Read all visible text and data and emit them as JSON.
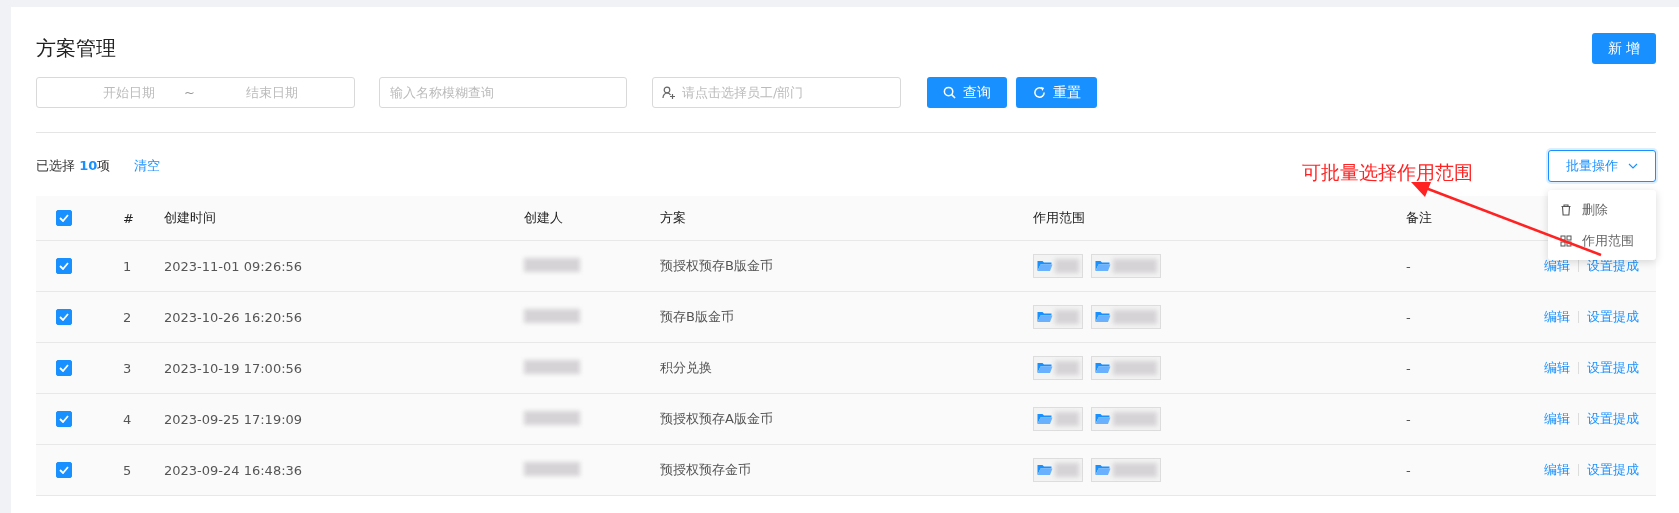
{
  "page": {
    "title": "方案管理",
    "add_button": "新 增"
  },
  "filters": {
    "start_date": {
      "placeholder": "开始日期"
    },
    "separator": "~",
    "end_date": {
      "placeholder": "结束日期"
    },
    "name_search": {
      "placeholder": "输入名称模糊查询"
    },
    "employee_picker": {
      "placeholder": "请点击选择员工/部门"
    },
    "query_button": "查询",
    "reset_button": "重置"
  },
  "selection": {
    "summary": "已选择 **10**项",
    "clear_link": "清空"
  },
  "batch": {
    "button": "批量操作",
    "expanded": true,
    "menu": [
      {
        "kind": "trash",
        "label": "删除"
      },
      {
        "kind": "grid",
        "label": "作用范围"
      }
    ]
  },
  "annotation": {
    "text": "可批量选择作用范围"
  },
  "table": {
    "header_checked": true,
    "columns": [
      "#",
      "创建时间",
      "创建人",
      "方案",
      "作用范围",
      "备注"
    ],
    "rows": [
      {
        "checked": true,
        "index": "1",
        "created": "2023-11-01 09:26:56",
        "creator_blurred": true,
        "plan": "预授权预存B版金币",
        "scope_tags": [
          {
            "kind": "folder"
          },
          {
            "kind": "folder"
          }
        ],
        "note": "-",
        "actions": [
          "编辑",
          "设置提成"
        ]
      },
      {
        "checked": true,
        "index": "2",
        "created": "2023-10-26 16:20:56",
        "creator_blurred": true,
        "plan": "预存B版金币",
        "scope_tags": [
          {
            "kind": "folder"
          },
          {
            "kind": "folder"
          }
        ],
        "note": "-",
        "actions": [
          "编辑",
          "设置提成"
        ]
      },
      {
        "checked": true,
        "index": "3",
        "created": "2023-10-19 17:00:56",
        "creator_blurred": true,
        "plan": "积分兑换",
        "scope_tags": [
          {
            "kind": "folder"
          },
          {
            "kind": "folder"
          }
        ],
        "note": "-",
        "actions": [
          "编辑",
          "设置提成"
        ]
      },
      {
        "checked": true,
        "index": "4",
        "created": "2023-09-25 17:19:09",
        "creator_blurred": true,
        "plan": "预授权预存A版金币",
        "scope_tags": [
          {
            "kind": "folder"
          },
          {
            "kind": "folder"
          }
        ],
        "note": "-",
        "actions": [
          "编辑",
          "设置提成"
        ]
      },
      {
        "checked": true,
        "index": "5",
        "created": "2023-09-24 16:48:36",
        "creator_blurred": true,
        "plan": "预授权预存金币",
        "scope_tags": [
          {
            "kind": "folder"
          },
          {
            "kind": "folder"
          }
        ],
        "note": "-",
        "actions": [
          "编辑",
          "设置提成"
        ]
      }
    ]
  }
}
